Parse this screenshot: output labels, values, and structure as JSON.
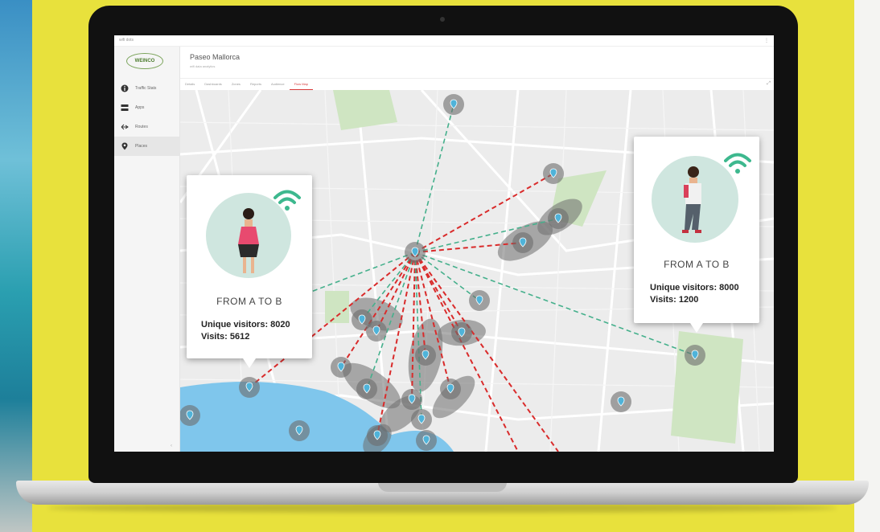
{
  "app": {
    "topbar_label": "wifi dots",
    "logo_text": "WEINCO",
    "title": "Paseo Mallorca",
    "subtitle": "wifi data analytics",
    "corner_glyph": "⋮"
  },
  "sidebar": {
    "items": [
      {
        "label": "Traffic Stats",
        "icon": "info-icon"
      },
      {
        "label": "Apps",
        "icon": "grid-icon"
      },
      {
        "label": "Routes",
        "icon": "route-icon"
      },
      {
        "label": "Places",
        "icon": "pin-icon"
      }
    ],
    "footer_glyph": "‹"
  },
  "tabs": {
    "items": [
      "Details",
      "Dashboards",
      "Zones",
      "Reports",
      "Audience",
      "Flow Map"
    ],
    "active_index": 5,
    "end_glyph": "⤢"
  },
  "popups": {
    "left": {
      "heading": "FROM A TO B",
      "unique_visitors": "Unique visitors: 8020",
      "visits": "Visits: 5612"
    },
    "right": {
      "heading": "FROM A TO B",
      "unique_visitors": "Unique visitors: 8000",
      "visits": "Visits: 1200"
    }
  },
  "colors": {
    "flow_red": "#d92b2b",
    "flow_green": "#45b08c",
    "zone_gray": "#6d6d6d",
    "pin": "#4fb3d9",
    "water": "#7fc6ec",
    "park": "#cfe5c2",
    "wifi": "#3db88e",
    "accent_tab": "#d83a3a"
  }
}
